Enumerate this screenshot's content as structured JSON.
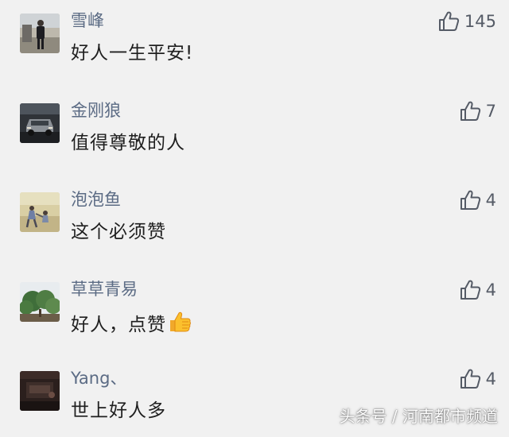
{
  "comments": [
    {
      "username": "雪峰",
      "content": "好人一生平安!",
      "likes": "145",
      "avatar_icon": "avatar-person-standing-photo"
    },
    {
      "username": "金刚狼",
      "content": "值得尊敬的人",
      "likes": "7",
      "avatar_icon": "avatar-car-photo"
    },
    {
      "username": "泡泡鱼",
      "content": "这个必须赞",
      "likes": "4",
      "avatar_icon": "avatar-beach-people-photo"
    },
    {
      "username": "草草青易",
      "content": "好人，点赞",
      "likes": "4",
      "avatar_icon": "avatar-trees-photo"
    },
    {
      "username": "Yang、",
      "content": "世上好人多",
      "likes": "4",
      "avatar_icon": "avatar-dark-room-photo"
    }
  ],
  "like_icon": "thumbs-up-outline-icon",
  "emoji": "thumbs-up-emoji",
  "watermark": "头条号 / 河南都市频道",
  "colors": {
    "background": "#f1f1f1",
    "username": "#5b6b84",
    "content": "#1f1f1f",
    "like": "#555b66"
  }
}
